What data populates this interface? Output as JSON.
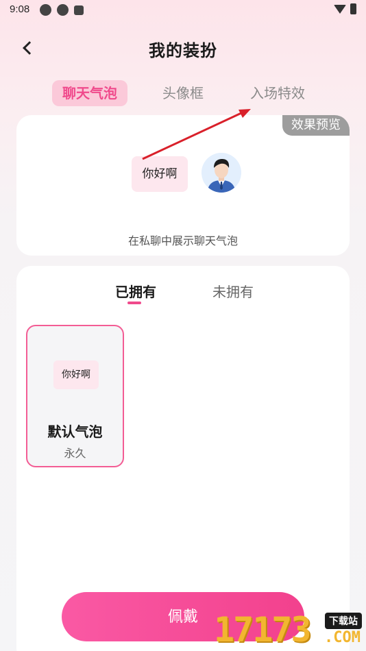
{
  "status_bar": {
    "time": "9:08"
  },
  "header": {
    "title": "我的装扮"
  },
  "tabs": [
    {
      "label": "聊天气泡",
      "active": true
    },
    {
      "label": "头像框",
      "active": false
    },
    {
      "label": "入场特效",
      "active": false
    }
  ],
  "preview": {
    "tag": "效果预览",
    "bubble_text": "你好啊",
    "caption": "在私聊中展示聊天气泡"
  },
  "owned": {
    "tabs": [
      {
        "label": "已拥有",
        "active": true
      },
      {
        "label": "未拥有",
        "active": false
      }
    ],
    "items": [
      {
        "bubble_text": "你好啊",
        "name": "默认气泡",
        "duration": "永久",
        "selected": true
      }
    ]
  },
  "action_button": {
    "label": "佩戴"
  },
  "watermark": {
    "digits": "17173",
    "badge": "下载站",
    "domain": ".COM"
  },
  "colors": {
    "accent": "#f04a8c",
    "bubble": "#fde7ee",
    "annotation_arrow": "#d9202a"
  }
}
